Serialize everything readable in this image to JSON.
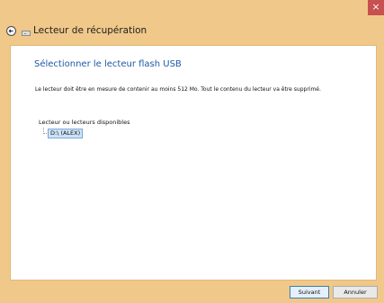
{
  "window": {
    "close_glyph": "×",
    "title": "Lecteur de récupération"
  },
  "page": {
    "heading": "Sélectionner le lecteur flash USB",
    "description": "Le lecteur doit être en mesure de contenir au moins 512 Mo. Tout le contenu du lecteur va être supprimé.",
    "drives_label": "Lecteur ou lecteurs disponibles",
    "drives": [
      {
        "label": "D:\\ (ALEX)",
        "selected": true
      }
    ]
  },
  "buttons": {
    "next": "Suivant",
    "cancel": "Annuler"
  },
  "colors": {
    "frame": "#f0c88a",
    "heading": "#1c5aa6",
    "close": "#c75050",
    "selection": "#cfe3f7"
  },
  "icons": {
    "back": "back-arrow-icon",
    "drive": "drive-icon",
    "close": "close-icon"
  }
}
